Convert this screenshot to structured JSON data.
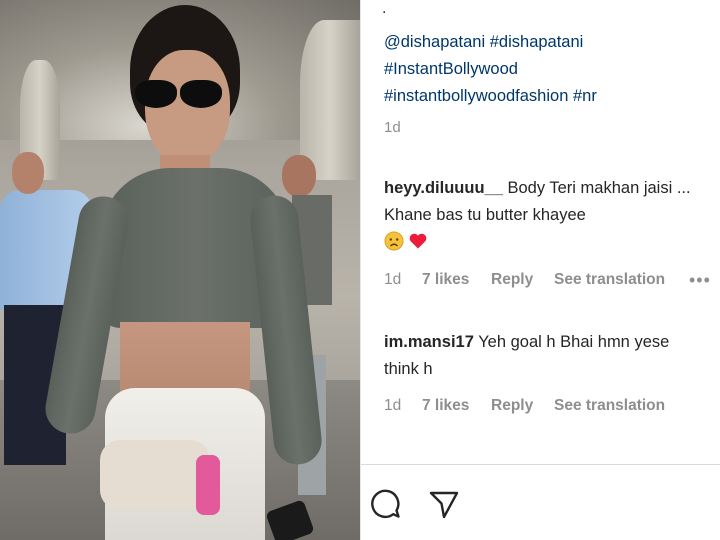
{
  "post": {
    "dot": ".",
    "caption_tags": [
      "@dishapatani",
      "#dishapatani",
      "#InstantBollywood",
      "#instantbollywoodfashion",
      "#nr"
    ],
    "age": "1d"
  },
  "comments": [
    {
      "username": "heyy.diluuuu__",
      "text": "Body Teri makhan jaisi ... Khane bas tu butter khayee",
      "emojis": [
        "sad-face-emoji",
        "red-heart-emoji"
      ],
      "age": "1d",
      "likes": "7 likes",
      "reply": "Reply",
      "translate": "See translation",
      "more": "•••"
    },
    {
      "username": "im.mansi17",
      "text": "Yeh goal h Bhai hmn yese think h",
      "age": "1d",
      "likes": "7 likes",
      "reply": "Reply",
      "translate": "See translation"
    }
  ],
  "actions": {
    "icons": [
      "comment-icon",
      "share-icon"
    ]
  },
  "colors": {
    "link": "#00376b",
    "text": "#262626",
    "muted": "#8e8e8e",
    "heart": "#ed4956",
    "emoji_face": "#f5c33b"
  }
}
